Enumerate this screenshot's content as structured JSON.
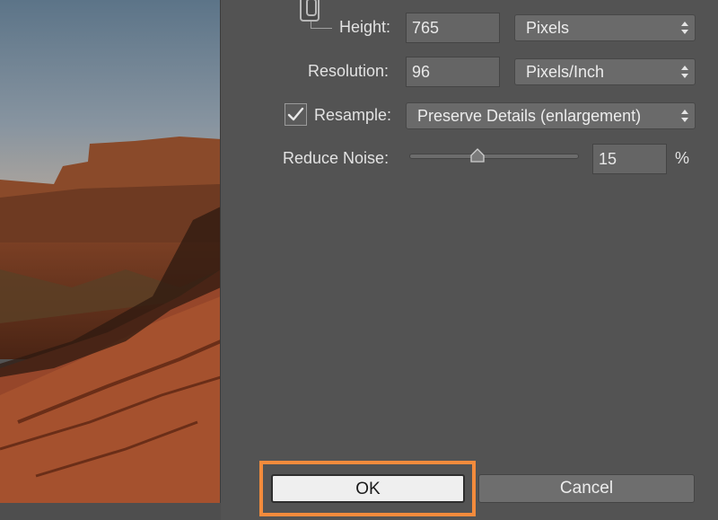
{
  "dialog": {
    "height": {
      "label": "Height:",
      "value": "765",
      "unit": "Pixels"
    },
    "resolution": {
      "label": "Resolution:",
      "value": "96",
      "unit": "Pixels/Inch"
    },
    "resample": {
      "label": "Resample:",
      "checked": true,
      "method": "Preserve Details (enlargement)"
    },
    "reduce_noise": {
      "label": "Reduce Noise:",
      "value": "15",
      "unit": "%",
      "level": 0.4
    },
    "buttons": {
      "ok": "OK",
      "cancel": "Cancel"
    }
  },
  "colors": {
    "panel": "#535353",
    "highlight": "#f38b3c",
    "ok_button": "#efefef"
  },
  "icons": [
    "link-icon",
    "checkmark-icon",
    "dropdown-arrows-icon",
    "slider-thumb-icon"
  ]
}
